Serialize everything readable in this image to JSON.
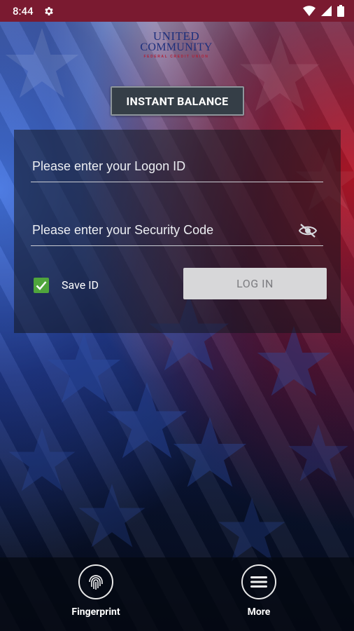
{
  "status_bar": {
    "time": "8:44",
    "icons": [
      "settings-icon",
      "wifi-icon",
      "signal-icon",
      "battery-icon"
    ]
  },
  "logo": {
    "line1": "UNITED",
    "line2": "COMMUNITY",
    "line3": "FEDERAL CREDIT UNION"
  },
  "instant_balance": {
    "label": "INSTANT BALANCE"
  },
  "login": {
    "logon_placeholder": "Please enter your Logon ID",
    "logon_value": "",
    "security_placeholder": "Please enter your Security Code",
    "security_value": "",
    "save_id_label": "Save ID",
    "save_id_checked": true,
    "login_label": "LOG IN"
  },
  "bottom_nav": {
    "fingerprint_label": "Fingerprint",
    "more_label": "More"
  },
  "colors": {
    "status_bar": "#7a1a30",
    "checkbox": "#4fa53c",
    "login_button": "#d7d7d9",
    "logo_blue": "#1d2f7c",
    "logo_red": "#b21f36"
  }
}
